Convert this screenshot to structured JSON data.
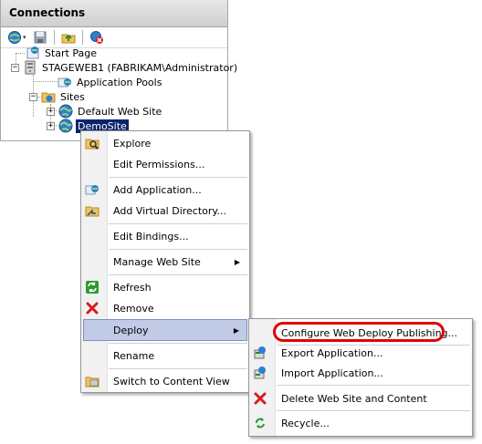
{
  "panel": {
    "title": "Connections"
  },
  "toolbar": {
    "dropdown_glyph": "▾"
  },
  "tree": {
    "start_page": "Start Page",
    "server": "STAGEWEB1 (FABRIKAM\\Administrator)",
    "app_pools": "Application Pools",
    "sites": "Sites",
    "default_site": "Default Web Site",
    "demo_site": "DemoSite",
    "expand_glyph": "+",
    "collapse_glyph": "−"
  },
  "context_menu": {
    "explore": "Explore",
    "edit_permissions": "Edit Permissions...",
    "add_application": "Add Application...",
    "add_virtual_directory": "Add Virtual Directory...",
    "edit_bindings": "Edit Bindings...",
    "manage_web_site": "Manage Web Site",
    "refresh": "Refresh",
    "remove": "Remove",
    "deploy": "Deploy",
    "rename": "Rename",
    "switch_content_view": "Switch to Content View",
    "submenu_arrow": "▶"
  },
  "deploy_menu": {
    "configure": "Configure Web Deploy Publishing...",
    "export_app": "Export Application...",
    "import_app": "Import Application...",
    "delete_site": "Delete Web Site and Content",
    "recycle": "Recycle..."
  },
  "colors": {
    "selection": "#0a246a",
    "highlight": "#c2cbe6",
    "callout": "#e00000"
  }
}
